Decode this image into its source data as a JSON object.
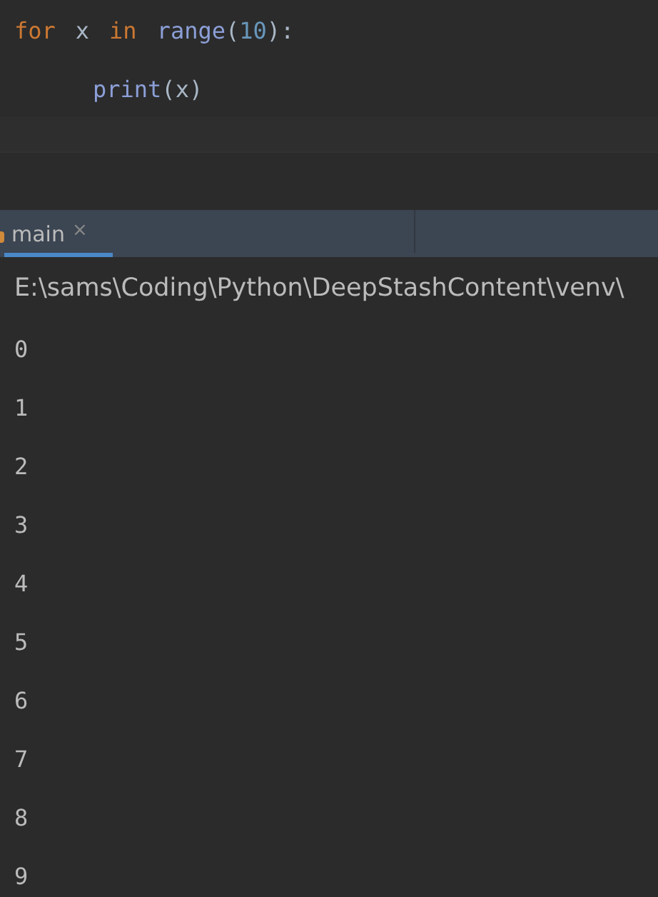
{
  "editor": {
    "lines": [
      {
        "tokens": [
          {
            "kind": "keyword",
            "text": "for"
          },
          {
            "kind": "name",
            "text": "x"
          },
          {
            "kind": "keyword",
            "text": "in"
          },
          {
            "kind": "builtin",
            "text": "range"
          },
          {
            "kind": "punct",
            "text": "("
          },
          {
            "kind": "number",
            "text": "10"
          },
          {
            "kind": "punct",
            "text": "):"
          }
        ],
        "indent": false
      },
      {
        "tokens": [
          {
            "kind": "builtin",
            "text": "print"
          },
          {
            "kind": "punct",
            "text": "("
          },
          {
            "kind": "name",
            "text": "x"
          },
          {
            "kind": "punct",
            "text": ")"
          }
        ],
        "indent": true
      }
    ]
  },
  "run_tabs": [
    {
      "label": "main",
      "close": "×",
      "selected": true
    }
  ],
  "console": {
    "command": "E:\\sams\\Coding\\Python\\DeepStashContent\\venv\\",
    "output": [
      "0",
      "1",
      "2",
      "3",
      "4",
      "5",
      "6",
      "7",
      "8",
      "9"
    ]
  }
}
